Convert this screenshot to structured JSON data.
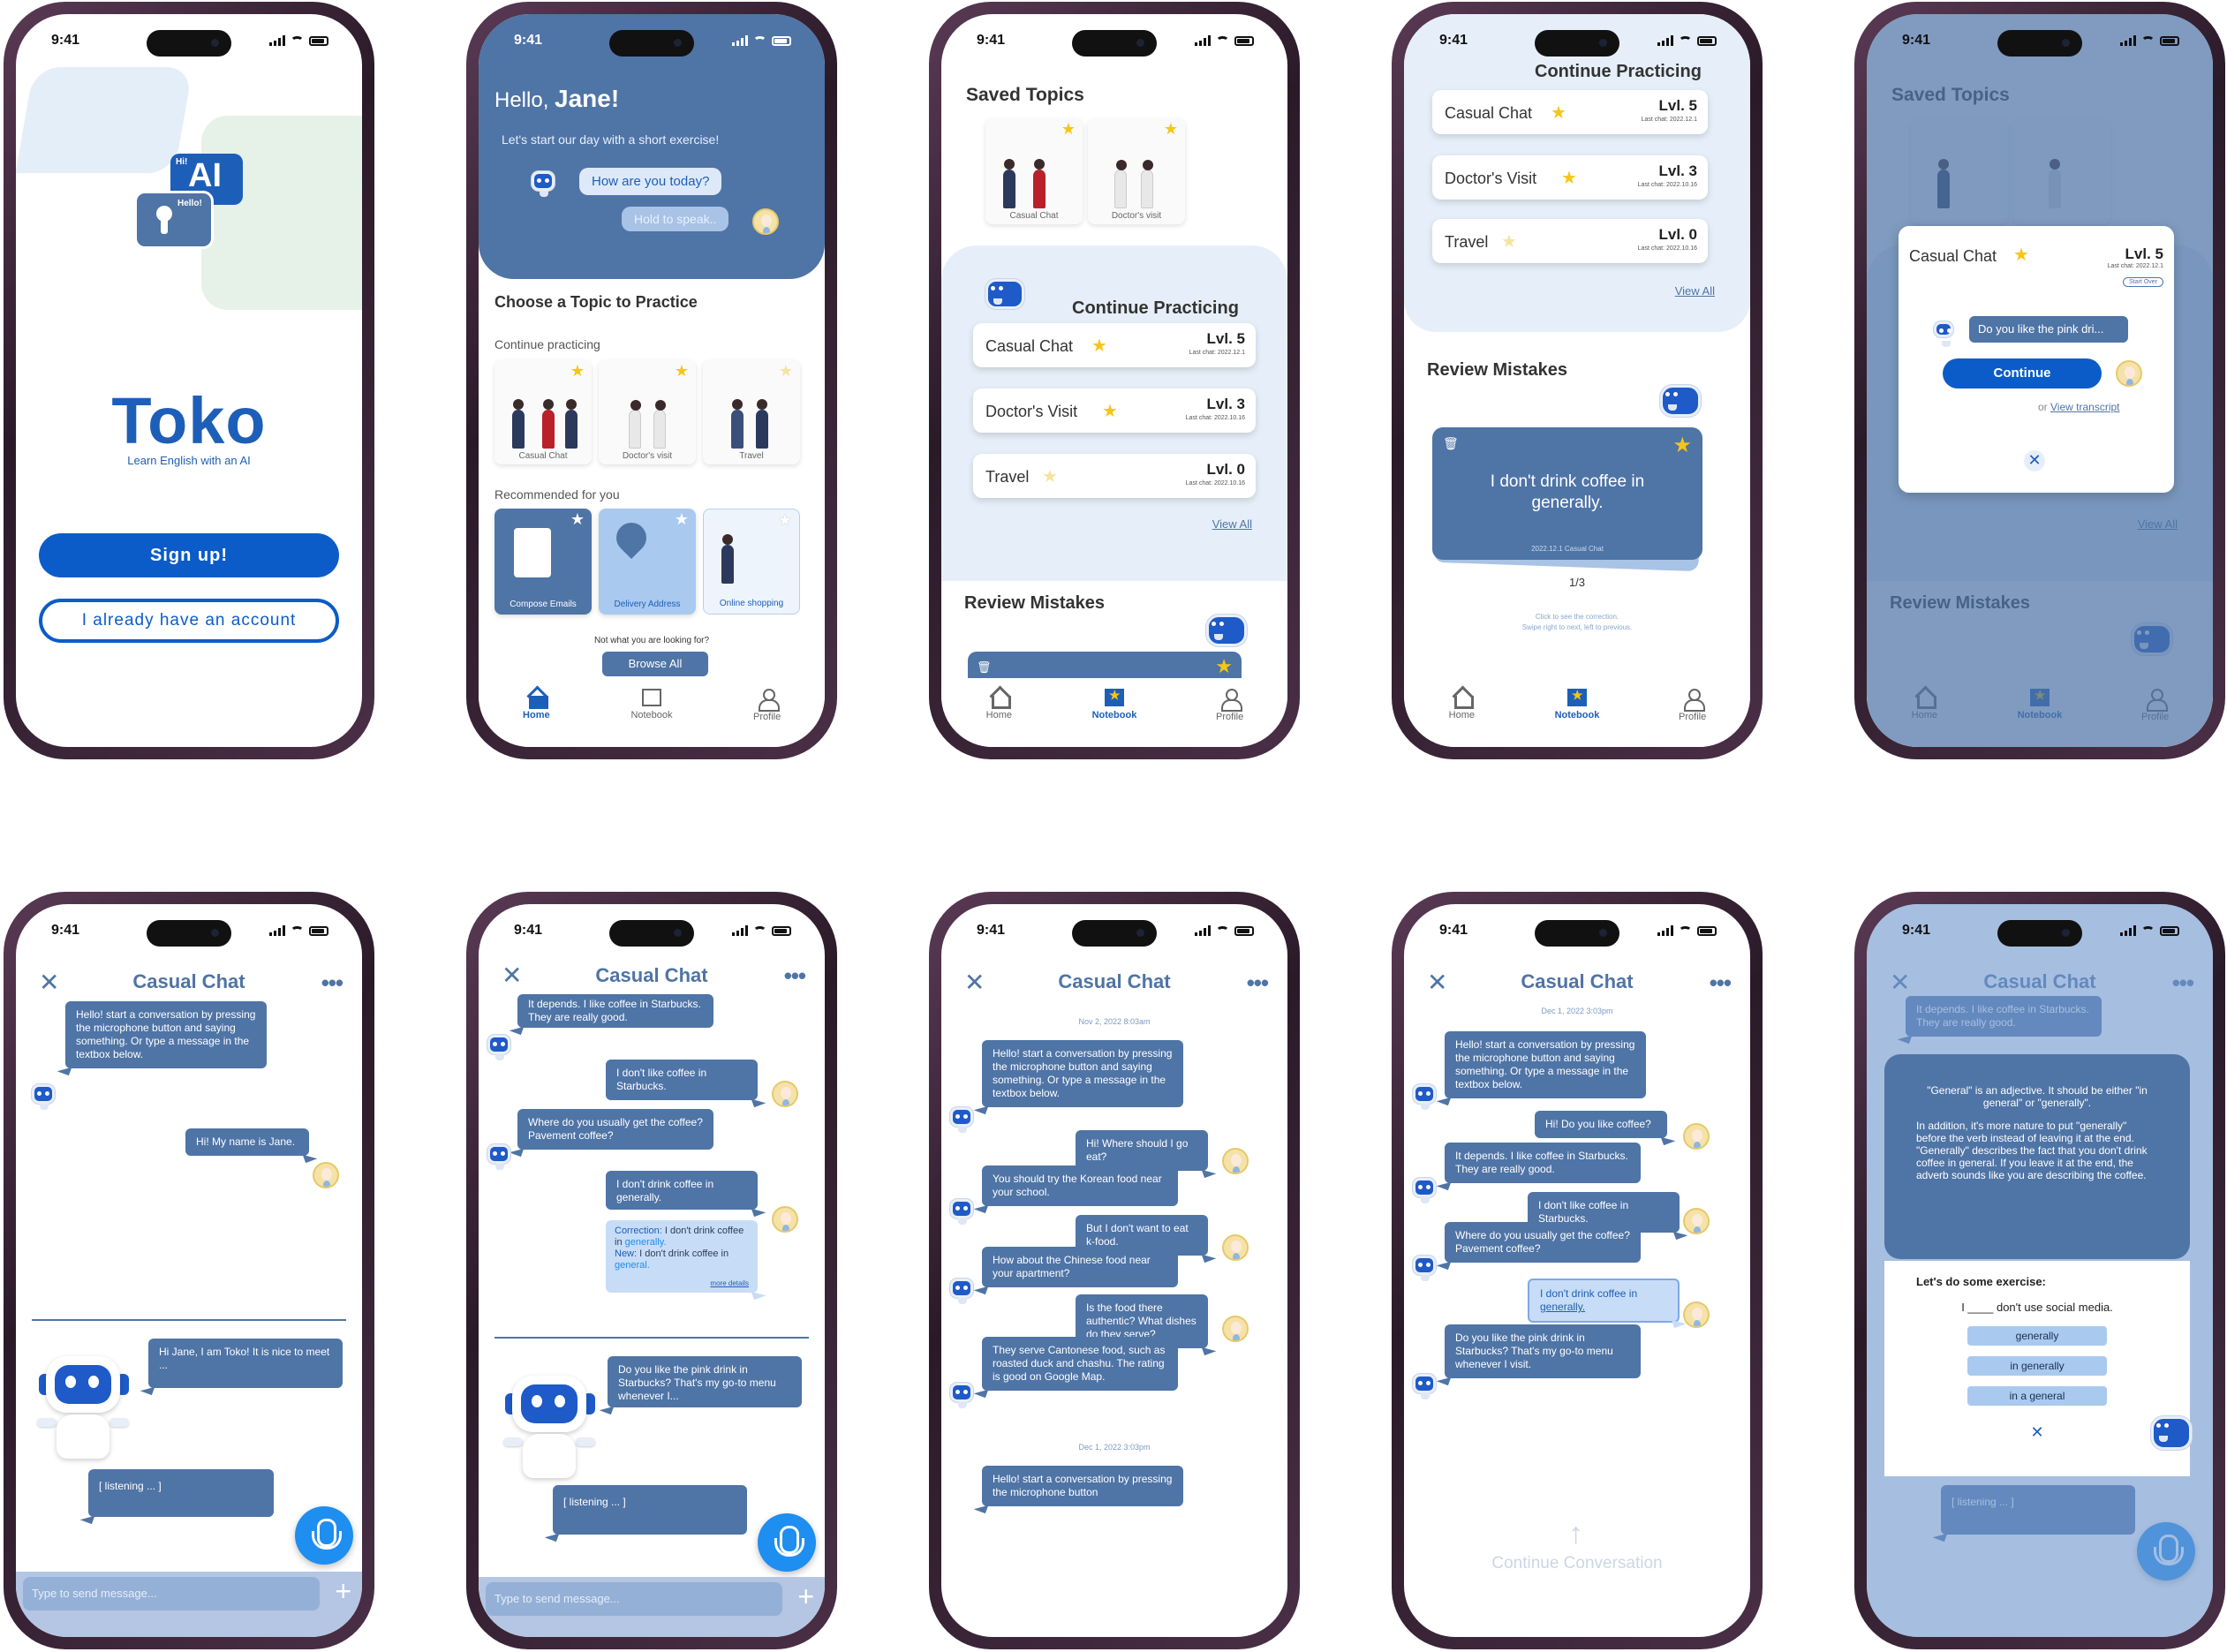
{
  "status_time": "9:41",
  "tabs": {
    "home": "Home",
    "notebook": "Notebook",
    "profile": "Profile"
  },
  "welcome": {
    "bubble_big": "AI",
    "bubble_hi": "Hi!",
    "bubble_hello": "Hello!",
    "logo": "Toko",
    "tagline": "Learn English with an AI",
    "signup": "Sign up!",
    "login": "I already have an account"
  },
  "home": {
    "greeting_prefix": "Hello,",
    "greeting_name": "Jane!",
    "subtitle": "Let's start our day with a short exercise!",
    "prompt": "How are you today?",
    "hold": "Hold to speak..",
    "section_title": "Choose a Topic to Practice",
    "continue_label": "Continue practicing",
    "continue_topics": [
      "Casual Chat",
      "Doctor's visit",
      "Travel"
    ],
    "recommended_label": "Recommended for you",
    "recommended": [
      "Compose Emails",
      "Delivery Address",
      "Online shopping"
    ],
    "not_found": "Not what you are looking for?",
    "browse": "Browse All"
  },
  "notebook": {
    "saved_title": "Saved Topics",
    "saved": [
      "Casual Chat",
      "Doctor's visit"
    ],
    "continue_title": "Continue Practicing",
    "practice": [
      {
        "name": "Casual Chat",
        "level": "Lvl. 5",
        "last": "Last chat: 2022.12.1"
      },
      {
        "name": "Doctor's Visit",
        "level": "Lvl. 3",
        "last": "Last chat: 2022.10.16"
      },
      {
        "name": "Travel",
        "level": "Lvl. 0",
        "last": "Last chat: 2022.10.16"
      }
    ],
    "view_all": "View All",
    "review_title": "Review Mistakes",
    "mistake_text": "I don't drink coffee in generally.",
    "mistake_meta": "2022.12.1 Casual Chat",
    "mistake_page": "1/3",
    "hint1": "Click to see the correction.",
    "hint2": "Swipe right to next, left to previous."
  },
  "popup": {
    "start_over": "Start Over",
    "question": "Do you like the pink dri...",
    "continue": "Continue",
    "or": "or",
    "transcript": "View transcript"
  },
  "chat": {
    "title": "Casual Chat",
    "placeholder": "Type to send message...",
    "listening": "[ listening ... ]",
    "intro": "Hello! start a conversation by pressing the microphone button and saying something. Or type a message in the textbox below.",
    "my_name": "Hi! My name is Jane.",
    "toko_intro": "Hi Jane, I am Toko! It is nice to meet ...",
    "m_depends": "It depends. I like coffee in Starbucks. They are really good.",
    "m_dont_like": "I don't like coffee in Starbucks.",
    "m_where": "Where do you usually get the coffee? Pavement coffee?",
    "m_dont_drink": "I don't drink coffee in generally.",
    "correction_label": "Correction:",
    "correction_a": "I don't drink coffee in",
    "correction_wrong": "generally.",
    "new_label": "New:",
    "correction_b": "I don't drink coffee in",
    "correction_right": "general.",
    "more_details": "more details",
    "m_pink": "Do you like the pink drink in Starbucks? That's my go-to menu whenever I...",
    "m_pink_full": "Do you like the pink drink in Starbucks? That's my go-to menu whenever I visit.",
    "date1": "Nov 2, 2022 8:03am",
    "date2": "Dec 1, 2022 3:03pm",
    "m_where_eat": "Hi! Where should I go eat?",
    "m_korean": "You should try the Korean food near your school.",
    "m_kfood": "But I don't want to eat k-food.",
    "m_chinese": "How about the Chinese food near your apartment?",
    "m_authentic": "Is the food there authentic? What dishes do they serve?",
    "m_cantonese": "They serve Cantonese food, such as roasted duck and chashu. The rating is good on Google Map.",
    "m_intro_short": "Hello! start a conversation by pressing the microphone button",
    "m_like_coffee": "Hi! Do you like coffee?",
    "continue_conv": "Continue Conversation"
  },
  "explain": {
    "p1": "\"General\" is an adjective. It should be either \"in general\" or \"generally\".",
    "p2": "In addition, it's more nature to put \"generally\" before the verb instead of leaving it at the end. \"Generally\" describes the fact that you don't drink coffee in general. If you leave it at the end, the adverb sounds like you are describing the coffee.",
    "exercise_title": "Let's do some exercise:",
    "sentence": "I ____ don't use social media.",
    "options": [
      "generally",
      "in generally",
      "in a general"
    ]
  },
  "colors": {
    "primary": "#0b5cc8",
    "bubble": "#4f74a6",
    "star": "#f5c518",
    "header": "#4f74a6"
  }
}
